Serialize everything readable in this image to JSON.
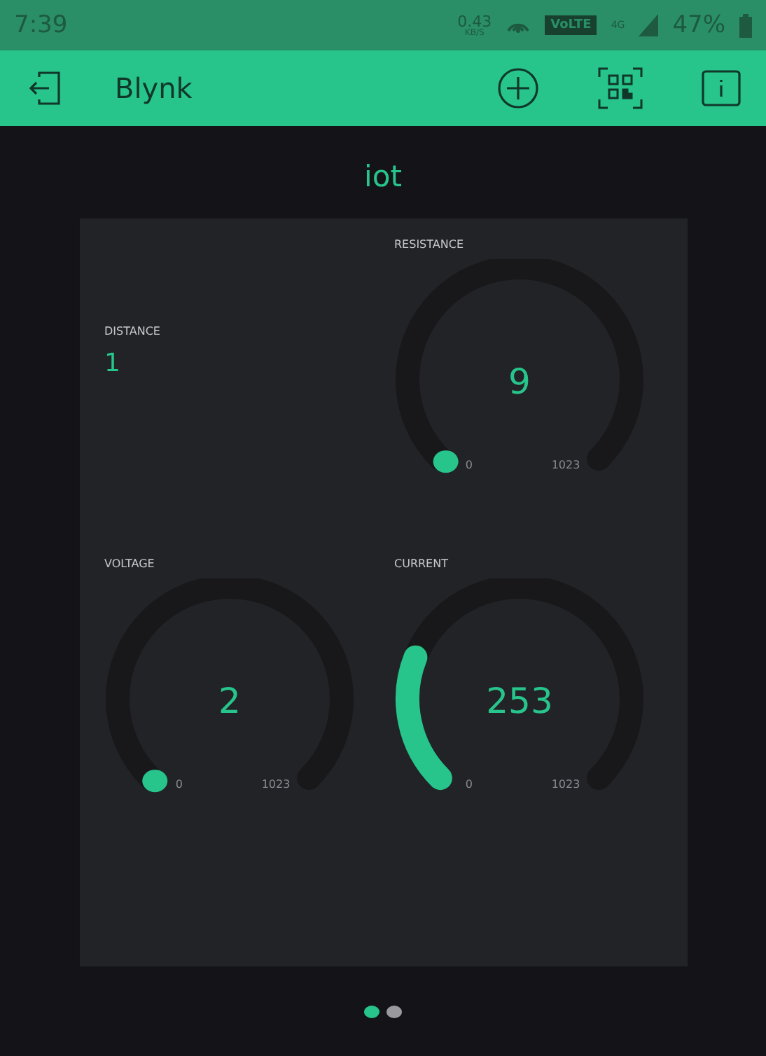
{
  "status_bar": {
    "time": "7:39",
    "speed": "0.43",
    "speed_unit": "KB/S",
    "volte": "VoLTE",
    "network": "4G",
    "battery": "47%"
  },
  "app_bar": {
    "title": "Blynk"
  },
  "project": {
    "title": "iot"
  },
  "widgets": [
    {
      "kind": "display",
      "label": "DISTANCE",
      "value": "1"
    },
    {
      "kind": "gauge",
      "label": "VOLTAGE",
      "value": "2",
      "min": "0",
      "max": "1023"
    },
    {
      "kind": "gauge",
      "label": "RESISTANCE",
      "value": "9",
      "min": "0",
      "max": "1023"
    },
    {
      "kind": "gauge",
      "label": "CURRENT",
      "value": "253",
      "min": "0",
      "max": "1023"
    }
  ],
  "pages": [
    {
      "selected": true
    },
    {
      "selected": false
    }
  ]
}
